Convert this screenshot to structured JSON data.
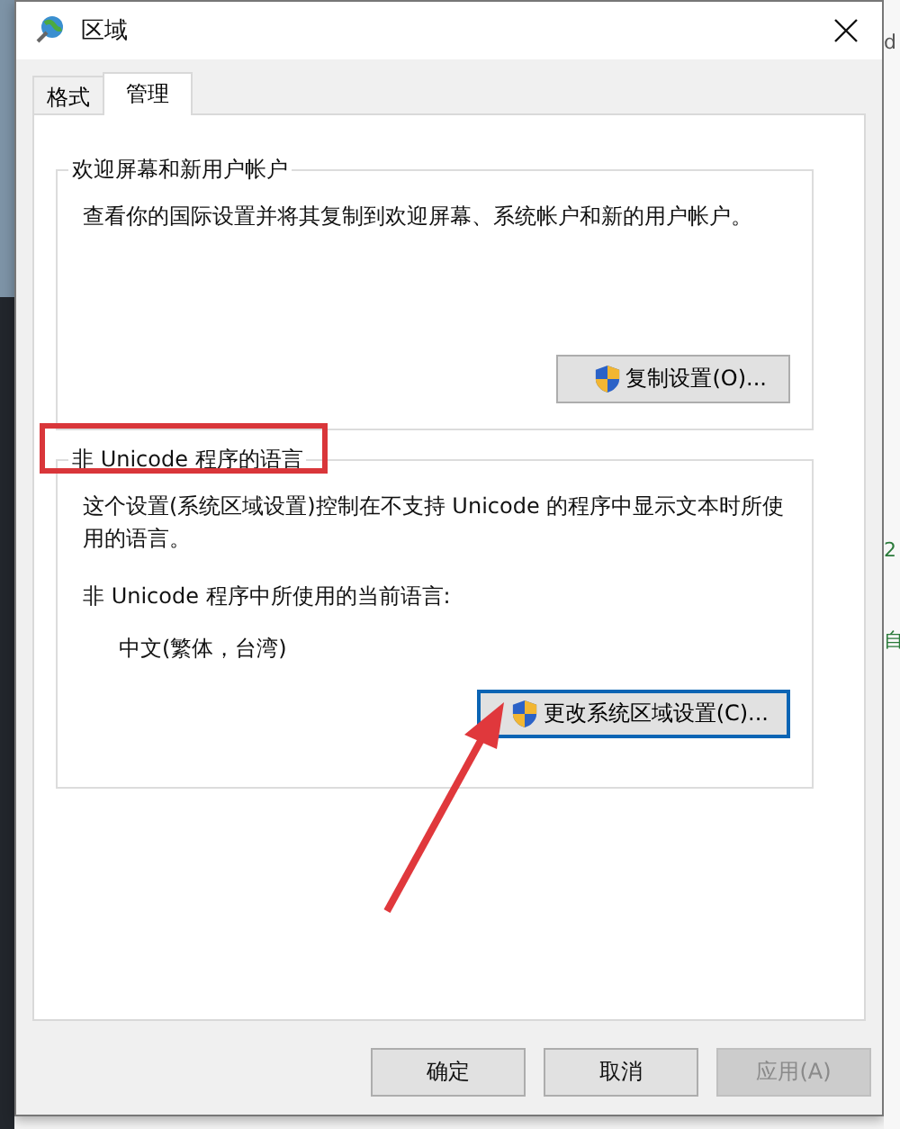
{
  "window": {
    "title": "区域"
  },
  "tabs": [
    {
      "label": "格式",
      "selected": false
    },
    {
      "label": "管理",
      "selected": true
    }
  ],
  "groups": [
    {
      "title": "欢迎屏幕和新用户帐户",
      "text": "查看你的国际设置并将其复制到欢迎屏幕、系统帐户和新的用户帐户。",
      "button": {
        "label": "复制设置(O)...",
        "focused": false
      }
    },
    {
      "title": "非 Unicode 程序的语言",
      "text": "这个设置(系统区域设置)控制在不支持 Unicode 的程序中显示文本时所使用的语言。",
      "label": "非 Unicode 程序中所使用的当前语言:",
      "value": "中文(繁体，台湾)",
      "button": {
        "label": "更改系统区域设置(C)...",
        "focused": true
      }
    }
  ],
  "buttons": [
    {
      "label": "确定",
      "disabled": false
    },
    {
      "label": "取消",
      "disabled": false
    },
    {
      "label": "应用(A)",
      "disabled": true
    }
  ],
  "background_window": {
    "texts": [
      "d",
      "2",
      "自"
    ]
  }
}
